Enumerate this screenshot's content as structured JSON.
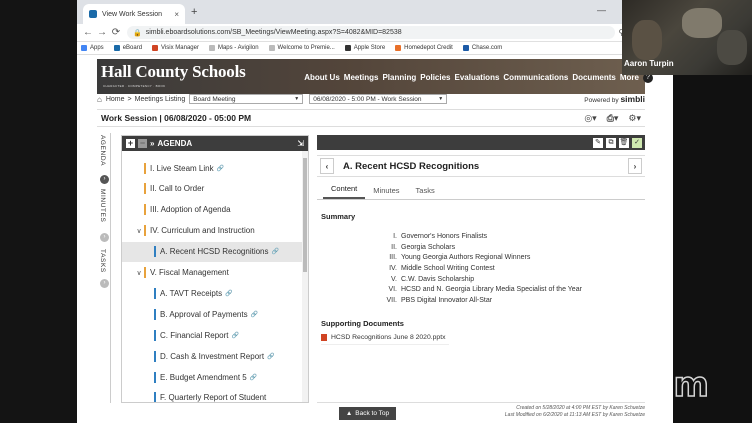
{
  "browser": {
    "tab_title": "View Work Session",
    "tab_close": "×",
    "new_tab": "+",
    "url": "simbli.eboardsolutions.com/SB_Meetings/ViewMeeting.aspx?S=4082&MID=82538"
  },
  "bookmarks": [
    "Apps",
    "eBoard",
    "Visix Manager",
    "Maps - Avigilon",
    "Welcome to Premie...",
    "Apple Store",
    "Homedepot Credit",
    "Chase.com"
  ],
  "site": {
    "logo_main": "Hall County Schools",
    "tagline": "CHARACTER · COMPETENCY · BOOK",
    "menu": [
      "About Us",
      "Meetings",
      "Planning",
      "Policies",
      "Evaluations",
      "Communications",
      "Documents",
      "More"
    ],
    "help": "?"
  },
  "crumb": {
    "home": "Home",
    "sep": ">",
    "listing": "Meetings Listing",
    "type_select": "Board Meeting",
    "meeting_select": "06/08/2020 - 5:00 PM - Work Session",
    "powered_by": "Powered by",
    "brand": "simbli"
  },
  "session_title": "Work Session | 06/08/2020 - 05:00 PM",
  "side_tabs": {
    "agenda": "AGENDA",
    "minutes": "MINUTES",
    "tasks": "TASKS"
  },
  "agenda": {
    "header": "AGENDA",
    "items": [
      {
        "label": "I. Live Steam Link",
        "color": "#e8a23c",
        "indent": 0,
        "toggle": "",
        "clip": true
      },
      {
        "label": "II. Call to Order",
        "color": "#e8a23c",
        "indent": 0,
        "toggle": "",
        "clip": false
      },
      {
        "label": "III. Adoption of Agenda",
        "color": "#e8a23c",
        "indent": 0,
        "toggle": "",
        "clip": false
      },
      {
        "label": "IV. Curriculum and Instruction",
        "color": "#e8a23c",
        "indent": 0,
        "toggle": "∨",
        "clip": false
      },
      {
        "label": "A. Recent HCSD Recognitions",
        "color": "#2f7fc1",
        "indent": 1,
        "toggle": "",
        "clip": true,
        "active": true
      },
      {
        "label": "V. Fiscal Management",
        "color": "#e8a23c",
        "indent": 0,
        "toggle": "∨",
        "clip": false
      },
      {
        "label": "A. TAVT Receipts",
        "color": "#2f7fc1",
        "indent": 1,
        "toggle": "",
        "clip": true
      },
      {
        "label": "B. Approval of Payments",
        "color": "#2f7fc1",
        "indent": 1,
        "toggle": "",
        "clip": true
      },
      {
        "label": "C. Financial Report",
        "color": "#2f7fc1",
        "indent": 1,
        "toggle": "",
        "clip": true
      },
      {
        "label": "D. Cash & Investment Report",
        "color": "#2f7fc1",
        "indent": 1,
        "toggle": "",
        "clip": true
      },
      {
        "label": "E. Budget Amendment 5",
        "color": "#2f7fc1",
        "indent": 1,
        "toggle": "",
        "clip": true
      },
      {
        "label": "F. Quarterly Report of Student",
        "color": "#2f7fc1",
        "indent": 1,
        "toggle": "",
        "clip": false
      }
    ]
  },
  "panel": {
    "title": "A. Recent HCSD Recognitions",
    "prev": "‹",
    "next": "›",
    "tabs": [
      "Content",
      "Minutes",
      "Tasks"
    ],
    "summary_heading": "Summary",
    "recognitions": [
      {
        "num": "I.",
        "text": "Governor's Honors Finalists"
      },
      {
        "num": "II.",
        "text": "Georgia Scholars"
      },
      {
        "num": "III.",
        "text": "Young Georgia Authors Regional Winners"
      },
      {
        "num": "IV.",
        "text": "Middle School Writing Contest"
      },
      {
        "num": "V.",
        "text": "C.W. Davis Scholarship"
      },
      {
        "num": "VI.",
        "text": "HCSD and N. Georgia Library Media Specialist of the Year"
      },
      {
        "num": "VII.",
        "text": "PBS Digital Innovator All-Star"
      }
    ],
    "docs_heading": "Supporting Documents",
    "document": "HCSD Recognitions June 8 2020.pptx",
    "back_to_top": "Back to Top",
    "created": "Created on 5/28/2020 at 4:00 PM EST by Karen Schuetze",
    "modified": "Last Modified on 6/2/2020 at 11:13 AM EST by Karen Schuetze"
  },
  "zoom": {
    "participant": "Aaron Turpin",
    "watermark": "zoom"
  },
  "colors": {
    "accent_orange": "#e8a23c",
    "accent_blue": "#2f7fc1",
    "header_dark": "#3d3d3d"
  }
}
